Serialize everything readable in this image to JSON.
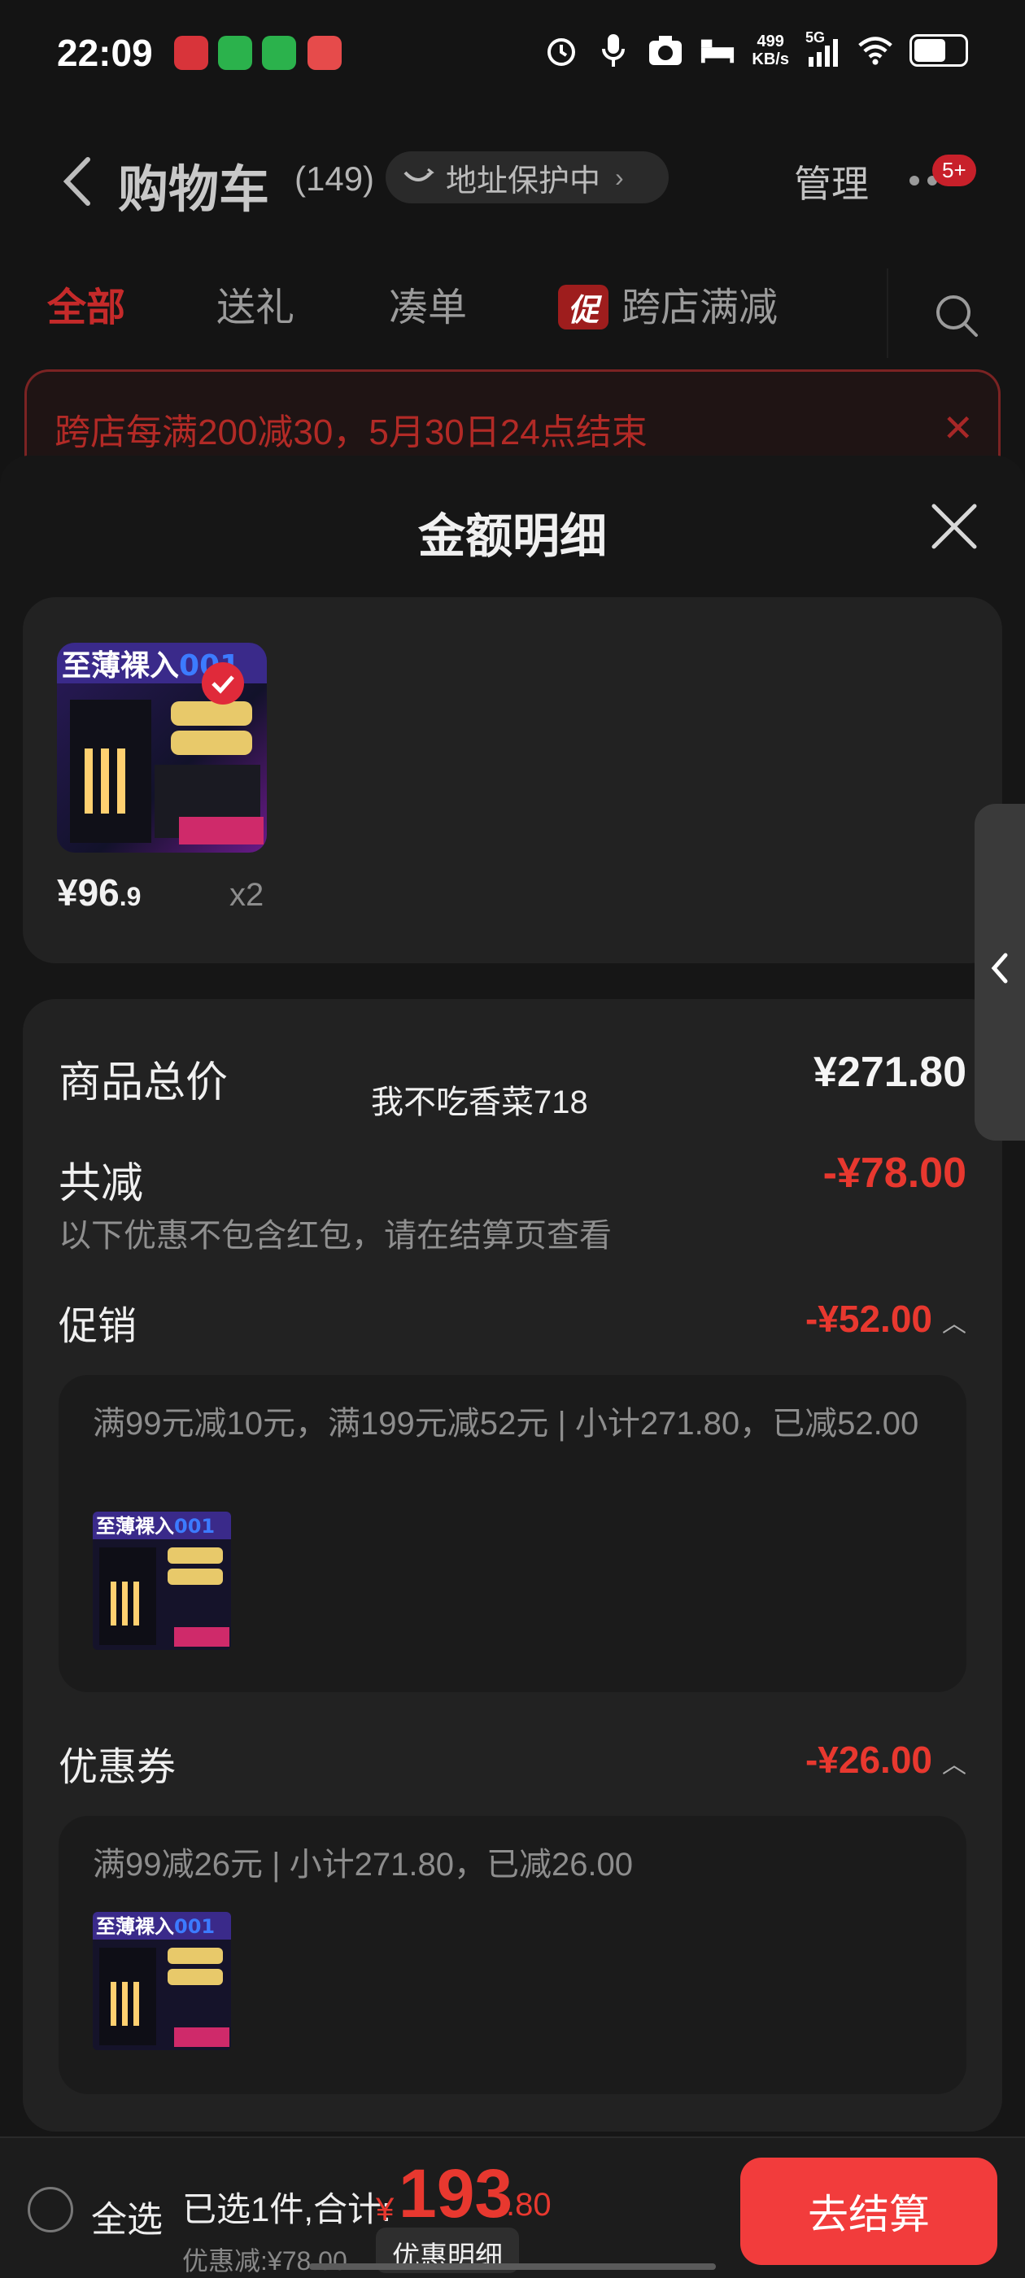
{
  "status_bar": {
    "time": "22:09",
    "net_speed_value": "499",
    "net_speed_unit": "KB/s",
    "signal_label": "5G",
    "icons": [
      "alarm-icon",
      "mic-icon",
      "camera-icon",
      "sleep-icon",
      "signal-icon",
      "wifi-icon",
      "battery-icon"
    ]
  },
  "header": {
    "title": "购物车",
    "count": "(149)",
    "address_pill": "地址保护中",
    "manage": "管理",
    "badge": "5+"
  },
  "tabs": [
    {
      "label": "全部",
      "active": true
    },
    {
      "label": "送礼",
      "active": false
    },
    {
      "label": "凑单",
      "active": false
    },
    {
      "label": "跨店满减",
      "tag": "促",
      "active": false
    }
  ],
  "banner": {
    "text": "跨店每满200减30，5月30日24点结束"
  },
  "sheet": {
    "title": "金额明细"
  },
  "product": {
    "image_caption": "至薄裸入001",
    "price_int": "¥96",
    "price_dec": ".9",
    "qty": "x2"
  },
  "detail": {
    "total_label": "商品总价",
    "total_value": "¥271.80",
    "watermark": "我不吃香菜718",
    "reduce_label": "共减",
    "reduce_value": "-¥78.00",
    "hint": "以下优惠不包含红包，请在结算页查看",
    "promo": {
      "label": "促销",
      "value": "-¥52.00",
      "rule": "满99元减10元，满199元减52元 | 小计271.80，已减52.00"
    },
    "coupon": {
      "label": "优惠券",
      "value": "-¥26.00",
      "rule": "满99减26元 | 小计271.80，已减26.00"
    }
  },
  "bottom_bar": {
    "select_all": "全选",
    "summary": "已选1件,合计:",
    "currency": "¥",
    "total_int": "193",
    "total_dec": ".80",
    "discount_note": "优惠减:¥78.00",
    "detail_button": "优惠明细",
    "checkout": "去结算"
  },
  "colors": {
    "accent_red": "#e8382f",
    "checkout_red": "#f23c3c",
    "background": "#141414",
    "card": "#222222"
  }
}
